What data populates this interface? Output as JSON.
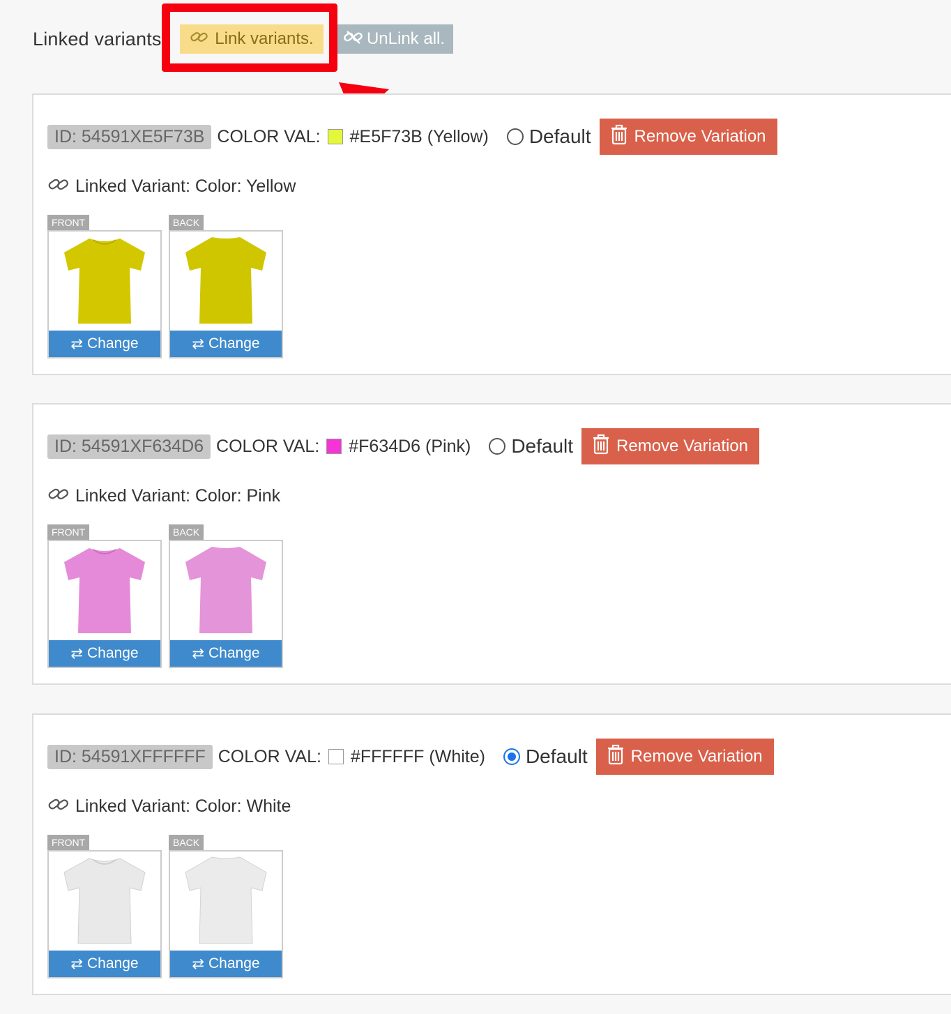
{
  "header": {
    "label": "Linked variants",
    "link_button": "Link variants.",
    "unlink_button": "UnLink all."
  },
  "variants": [
    {
      "id": "ID: 54591XE5F73B",
      "color_label": "COLOR VAL:",
      "hex_text": "#E5F73B (Yellow)",
      "swatch_color": "#E5F73B",
      "default_label": "Default",
      "default_checked": false,
      "remove_label": "Remove Variation",
      "linked_text": "Linked Variant: Color: Yellow",
      "front_tag": "FRONT",
      "back_tag": "BACK",
      "change_label": "Change",
      "shirt_color": "#d3c800"
    },
    {
      "id": "ID: 54591XF634D6",
      "color_label": "COLOR VAL:",
      "hex_text": "#F634D6 (Pink)",
      "swatch_color": "#F634D6",
      "default_label": "Default",
      "default_checked": false,
      "remove_label": "Remove Variation",
      "linked_text": "Linked Variant: Color: Pink",
      "front_tag": "FRONT",
      "back_tag": "BACK",
      "change_label": "Change",
      "shirt_color": "#e58ad9"
    },
    {
      "id": "ID: 54591XFFFFFF",
      "color_label": "COLOR VAL:",
      "hex_text": "#FFFFFF (White)",
      "swatch_color": "#FFFFFF",
      "default_label": "Default",
      "default_checked": true,
      "remove_label": "Remove Variation",
      "linked_text": "Linked Variant: Color: White",
      "front_tag": "FRONT",
      "back_tag": "BACK",
      "change_label": "Change",
      "shirt_color": "#e9e9e9"
    }
  ],
  "colors": {
    "accent_highlight": "#f5000f",
    "remove_button": "#d9604a",
    "change_button": "#3e8acc",
    "link_button_bg": "#f9dc8a",
    "unlink_button_bg": "#a9b7bf"
  },
  "icons": {
    "link": "link-icon",
    "unlink": "unlink-icon",
    "trash": "trash-icon",
    "swap": "swap-arrows-icon"
  }
}
